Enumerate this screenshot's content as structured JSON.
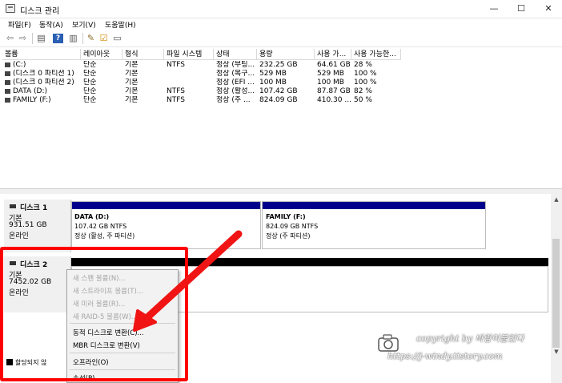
{
  "window": {
    "title": "디스크 관리",
    "minimize": "—",
    "maximize": "☐",
    "close": "✕"
  },
  "menu": [
    "파일(F)",
    "동작(A)",
    "보기(V)",
    "도움말(H)"
  ],
  "toolbar_icons": [
    "back-icon",
    "forward-icon",
    "list-icon",
    "help-icon",
    "panel-icon",
    "properties-icon",
    "check-icon",
    "window-icon"
  ],
  "volume_table": {
    "columns": [
      "볼륨",
      "레이아웃",
      "형식",
      "파일 시스템",
      "상태",
      "용량",
      "사용 가...",
      "사용 가능한..."
    ],
    "rows": [
      [
        "(C:)",
        "단순",
        "기본",
        "NTFS",
        "정상 (부팅...",
        "232.25 GB",
        "64.61 GB",
        "28 %"
      ],
      [
        "(디스크 0 파티션 1)",
        "단순",
        "기본",
        "",
        "정상 (복구...",
        "529 MB",
        "529 MB",
        "100 %"
      ],
      [
        "(디스크 0 파티션 2)",
        "단순",
        "기본",
        "",
        "정상 (EFI ...",
        "100 MB",
        "100 MB",
        "100 %"
      ],
      [
        "DATA (D:)",
        "단순",
        "기본",
        "NTFS",
        "정상 (활성...",
        "107.42 GB",
        "87.87 GB",
        "82 %"
      ],
      [
        "FAMILY (F:)",
        "단순",
        "기본",
        "NTFS",
        "정상 (주 ...",
        "824.09 GB",
        "410.30 ...",
        "50 %"
      ]
    ]
  },
  "disks": [
    {
      "name": "디스크 1",
      "type": "기본",
      "size": "931.51 GB",
      "status": "온라인",
      "partitions": [
        {
          "title": "DATA  (D:)",
          "line1": "107.42 GB NTFS",
          "line2": "정상 (활성, 주 파티션)"
        },
        {
          "title": "FAMILY  (F:)",
          "line1": "824.09 GB NTFS",
          "line2": "정상 (주 파티션)"
        }
      ]
    },
    {
      "name": "디스크 2",
      "type": "기본",
      "size": "7452.02 GB",
      "status": "온라인"
    }
  ],
  "legend": {
    "unallocated": "할당되지 않"
  },
  "context_menu": {
    "items": [
      {
        "label": "새 스팬 볼륨(N)...",
        "enabled": false
      },
      {
        "label": "새 스트라이프 볼륨(T)...",
        "enabled": false
      },
      {
        "label": "새 미러 볼륨(R)...",
        "enabled": false
      },
      {
        "label": "새 RAID-5 볼륨(W)...",
        "enabled": false
      },
      {
        "label": "동적 디스크로 변환(C)...",
        "enabled": true
      },
      {
        "label": "MBR 디스크로 변환(V)",
        "enabled": true
      },
      {
        "label": "오프라인(O)",
        "enabled": true
      },
      {
        "label": "속성(P)",
        "enabled": true
      }
    ]
  },
  "watermark": {
    "line1": "copyright by 바람이불었다",
    "line2": "https://j-windy.tistory.com"
  },
  "colors": {
    "partition_bar": "#00008b",
    "disk2_bar": "#000000",
    "annotation": "#ff0000"
  }
}
